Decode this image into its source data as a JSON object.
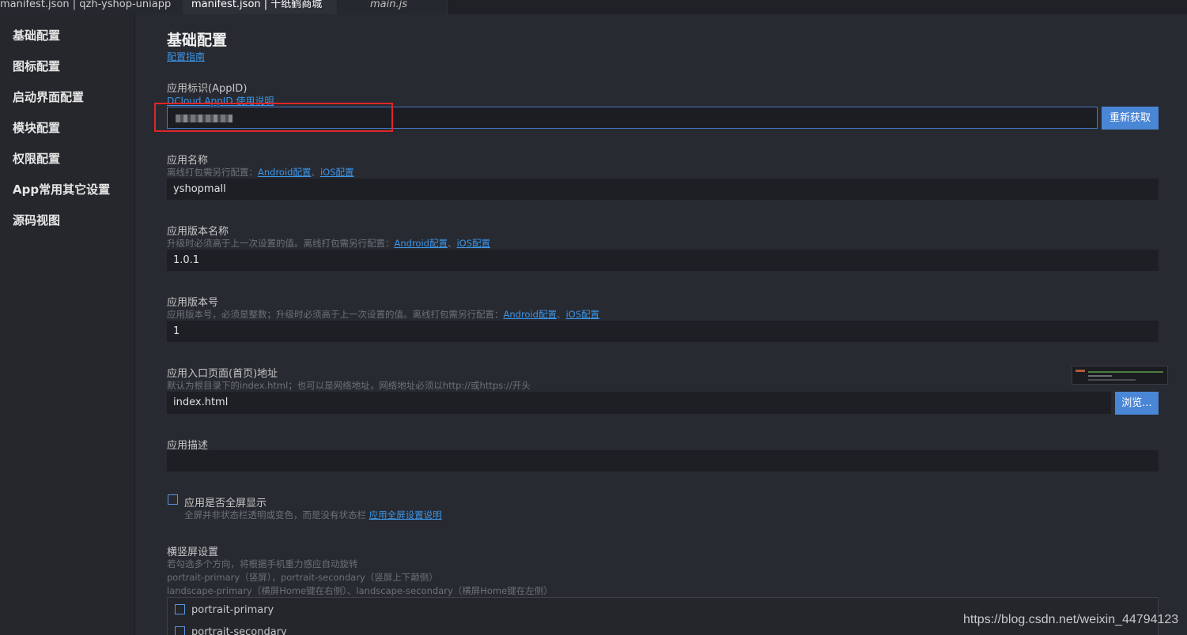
{
  "tabs": [
    {
      "label": "manifest.json | qzh-yshop-uniapp"
    },
    {
      "label": "manifest.json | 千纸鹤商城"
    },
    {
      "label": "main.js"
    }
  ],
  "sidebar": {
    "items": [
      {
        "label": "基础配置"
      },
      {
        "label": "图标配置"
      },
      {
        "label": "启动界面配置"
      },
      {
        "label": "模块配置"
      },
      {
        "label": "权限配置"
      },
      {
        "label": "App常用其它设置"
      },
      {
        "label": "源码视图"
      }
    ]
  },
  "main": {
    "title": "基础配置",
    "guide_link": "配置指南",
    "appid": {
      "label": "应用标识(AppID)",
      "doc_link": "DCloud AppID 使用说明",
      "button": "重新获取"
    },
    "app_name": {
      "label": "应用名称",
      "hint_prefix": "离线打包需另行配置：",
      "android_link": "Android配置",
      "sep": "、",
      "ios_link": "iOS配置",
      "value": "yshopmall"
    },
    "version_name": {
      "label": "应用版本名称",
      "hint_prefix": "升级时必须高于上一次设置的值。离线打包需另行配置：",
      "android_link": "Android配置",
      "sep": "、",
      "ios_link": "iOS配置",
      "value": "1.0.1"
    },
    "version_code": {
      "label": "应用版本号",
      "hint_prefix": "应用版本号，必须是整数；升级时必须高于上一次设置的值。离线打包需另行配置：",
      "android_link": "Android配置",
      "sep": "、",
      "ios_link": "iOS配置",
      "value": "1"
    },
    "entry_page": {
      "label": "应用入口页面(首页)地址",
      "hint": "默认为根目录下的index.html；也可以是网络地址，网络地址必须以http://或https://开头",
      "value": "index.html",
      "button": "浏览..."
    },
    "description": {
      "label": "应用描述",
      "value": ""
    },
    "fullscreen": {
      "label": "应用是否全屏显示",
      "checked": false,
      "hint_prefix": "全屏并非状态栏透明或变色，而是没有状态栏",
      "link": "应用全屏设置说明"
    },
    "orientation": {
      "label": "横竖屏设置",
      "hint1": "若勾选多个方向，将根据手机重力感应自动旋转",
      "hint2": "portrait-primary（竖屏），portrait-secondary（竖屏上下颠倒）",
      "hint3": "landscape-primary（横屏Home键在右侧）、landscape-secondary（横屏Home键在左侧）",
      "options": [
        {
          "label": "portrait-primary",
          "checked": false
        },
        {
          "label": "portrait-secondary",
          "checked": false
        }
      ]
    }
  },
  "watermark": "https://blog.csdn.net/weixin_44794123",
  "colors": {
    "accent": "#4a86d6",
    "link": "#3c95e8",
    "highlight_box": "#e0262a"
  }
}
